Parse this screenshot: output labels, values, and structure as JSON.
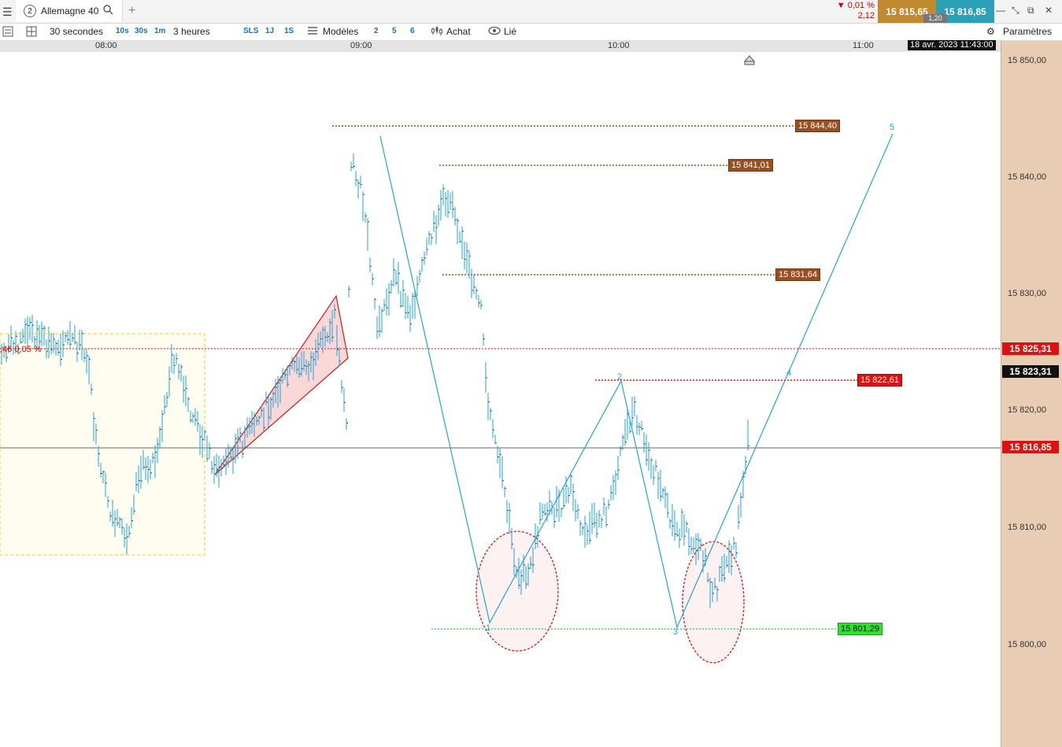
{
  "tabs": {
    "number": "2",
    "title": "Allemagne 40"
  },
  "quote": {
    "change_pct": "▼ 0,01 %",
    "change_abs": "2,12",
    "bid": "15 815,65",
    "ask": "15 816,85",
    "spread": "1,20"
  },
  "toolbar": {
    "interval": "30 secondes",
    "q10s": "10s",
    "q30s": "30s",
    "q1m": "1m",
    "range": "3 heures",
    "sls": "SLS",
    "r1j": "1J",
    "r1s": "1S",
    "templates": "Modèles",
    "n2": "2",
    "n5": "5",
    "n6": "6",
    "buy": "Achat",
    "linked": "Lié",
    "settings": "Paramètres"
  },
  "time_axis": {
    "t1": "08:00",
    "t2": "09:00",
    "t3": "10:00",
    "t4": "11:00",
    "cursor_date": "18 avr. 2023 11:43:00"
  },
  "price_axis": {
    "p1": "15 850,00",
    "p2": "15 840,00",
    "p3": "15 830,00",
    "p4": "15 820,00",
    "p5": "15 810,00",
    "p6": "15 800,00"
  },
  "labels": {
    "current": "15 816,85",
    "red_level": "15 825,31",
    "black_level": "15 823,31"
  },
  "levels": {
    "l1": "15 844,40",
    "l2": "15 841,01",
    "l3": "15 831,64",
    "l4": "15 822,61",
    "l5": "15 801,29"
  },
  "waves": {
    "w1": "1",
    "w2": "2",
    "w3": "3",
    "w4": "4",
    "w5": "5"
  },
  "annot": {
    "pct": ",46  0,05 %"
  },
  "colors": {
    "bid": "#c28a2f",
    "ask": "#2aa1b6",
    "bars": "#22a5d6",
    "wave": "#22a5d6",
    "red": "#e01010",
    "level_brown": "#9a4f1f",
    "green": "#33dd33"
  }
}
